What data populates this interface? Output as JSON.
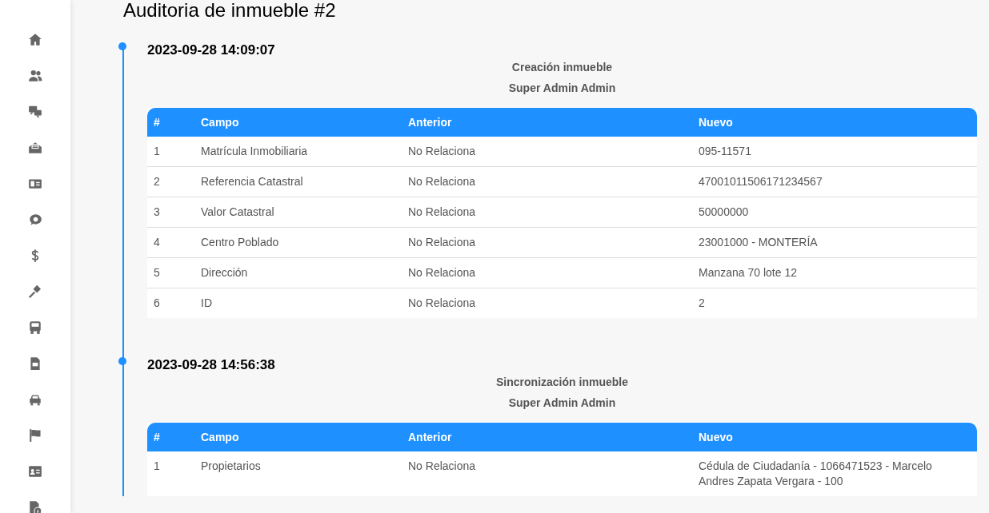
{
  "page_title": "Auditoria de inmueble #2",
  "timeline": [
    {
      "datetime": "2023-09-28 14:09:07",
      "action": "Creación inmueble",
      "user": "Super Admin Admin",
      "columns": [
        "#",
        "Campo",
        "Anterior",
        "Nuevo"
      ],
      "rows": [
        [
          "1",
          "Matrícula Inmobiliaria",
          "No Relaciona",
          "095-11571"
        ],
        [
          "2",
          "Referencia Catastral",
          "No Relaciona",
          "47001011506171234567"
        ],
        [
          "3",
          "Valor Catastral",
          "No Relaciona",
          "50000000"
        ],
        [
          "4",
          "Centro Poblado",
          "No Relaciona",
          "23001000 - MONTERÍA"
        ],
        [
          "5",
          "Dirección",
          "No Relaciona",
          "Manzana 70 lote 12"
        ],
        [
          "6",
          "ID",
          "No Relaciona",
          "2"
        ]
      ]
    },
    {
      "datetime": "2023-09-28 14:56:38",
      "action": "Sincronización inmueble",
      "user": "Super Admin Admin",
      "columns": [
        "#",
        "Campo",
        "Anterior",
        "Nuevo"
      ],
      "rows": [
        [
          "1",
          "Propietarios",
          "No Relaciona",
          "Cédula de Ciudadanía - 1066471523 - Marcelo Andres Zapata Vergara - 100"
        ]
      ]
    }
  ]
}
